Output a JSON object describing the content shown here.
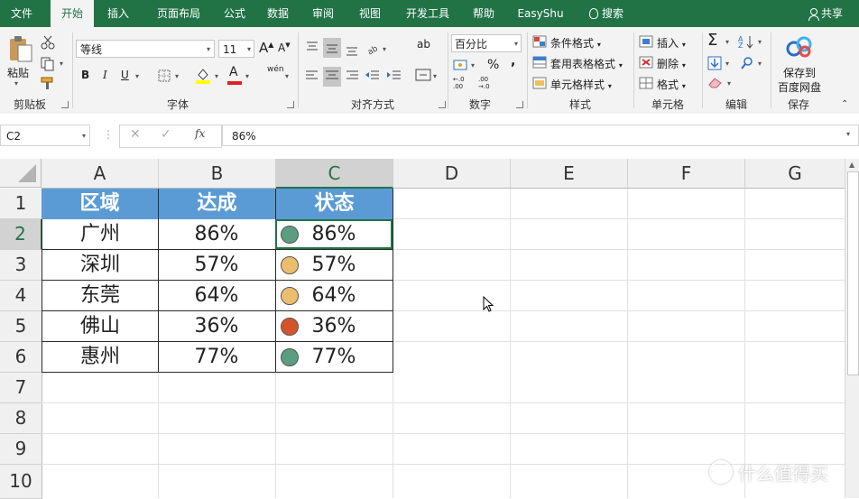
{
  "tabs": [
    {
      "label": "文件",
      "active": false
    },
    {
      "label": "开始",
      "active": true
    },
    {
      "label": "插入",
      "active": false
    },
    {
      "label": "页面布局",
      "active": false
    },
    {
      "label": "公式",
      "active": false
    },
    {
      "label": "数据",
      "active": false
    },
    {
      "label": "审阅",
      "active": false
    },
    {
      "label": "视图",
      "active": false
    },
    {
      "label": "开发工具",
      "active": false
    },
    {
      "label": "帮助",
      "active": false
    },
    {
      "label": "EasyShu",
      "active": false
    },
    {
      "label": "搜索",
      "active": false
    }
  ],
  "share_label": "共享",
  "clipboard": {
    "paste": "粘贴",
    "group": "剪贴板"
  },
  "font": {
    "name": "等线",
    "size": "11",
    "group": "字体",
    "bold": "B",
    "italic": "I",
    "underline": "U",
    "phonetic": "wén"
  },
  "alignment": {
    "group": "对齐方式",
    "wrap": "ab"
  },
  "number": {
    "format": "百分比",
    "group": "数字",
    "percent": "%",
    "comma": ",",
    "inc_decimal": "←.0 .00",
    "dec_decimal": ".00 →.0"
  },
  "styles": {
    "conditional": "条件格式",
    "table": "套用表格格式",
    "cell": "单元格样式",
    "group": "样式"
  },
  "cells": {
    "insert": "插入",
    "delete": "删除",
    "format": "格式",
    "group": "单元格"
  },
  "editing": {
    "group": "编辑",
    "sum": "Σ"
  },
  "save": {
    "line1": "保存到",
    "line2": "百度网盘",
    "group": "保存"
  },
  "namebox": "C2",
  "formula": "86%",
  "fx": "fx",
  "columns": [
    "A",
    "B",
    "C",
    "D",
    "E",
    "F",
    "G"
  ],
  "rows": [
    "1",
    "2",
    "3",
    "4",
    "5",
    "6",
    "7",
    "8",
    "9",
    "10"
  ],
  "table": {
    "headers": [
      "区域",
      "达成",
      "状态"
    ],
    "rows": [
      {
        "region": "广州",
        "rate": "86%",
        "status": "86%",
        "color": "#5a9e7f"
      },
      {
        "region": "深圳",
        "rate": "57%",
        "status": "57%",
        "color": "#edbd6e"
      },
      {
        "region": "东莞",
        "rate": "64%",
        "status": "64%",
        "color": "#edbd6e"
      },
      {
        "region": "佛山",
        "rate": "36%",
        "status": "36%",
        "color": "#d3552b"
      },
      {
        "region": "惠州",
        "rate": "77%",
        "status": "77%",
        "color": "#5a9e7f"
      }
    ],
    "header_color": "#5b9bd5"
  },
  "watermark": "什么值得买"
}
